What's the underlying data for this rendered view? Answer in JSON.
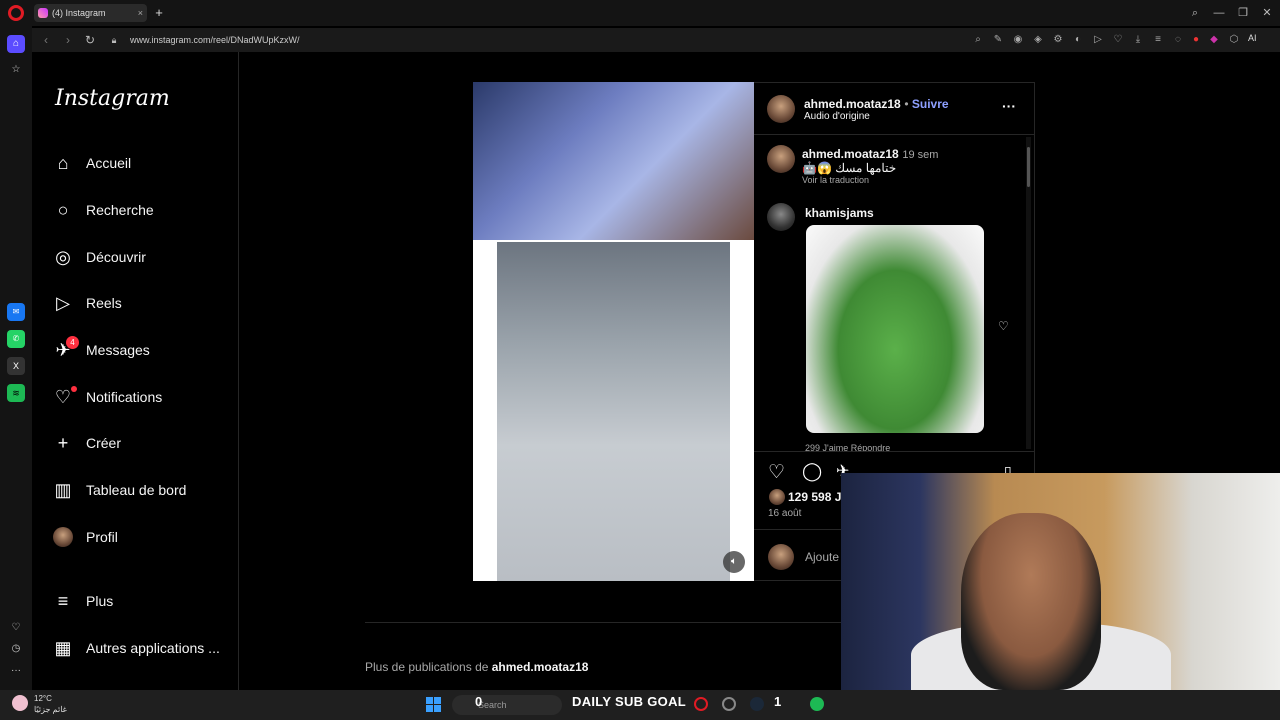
{
  "browser": {
    "tab_title": "(4) Instagram",
    "tab_close": "×",
    "new_tab": "+",
    "url": "www.instagram.com/reel/DNadWUpKzxW/",
    "ai_label": "AI",
    "window_controls": [
      "⌕",
      "—",
      "❐",
      "✕"
    ]
  },
  "nav": {
    "logo": "Instagram",
    "items": [
      {
        "label": "Accueil",
        "icon": "home-icon",
        "glyph": "⌂"
      },
      {
        "label": "Recherche",
        "icon": "search-icon",
        "glyph": "○"
      },
      {
        "label": "Découvrir",
        "icon": "compass-icon",
        "glyph": "◎"
      },
      {
        "label": "Reels",
        "icon": "reels-icon",
        "glyph": "▷"
      },
      {
        "label": "Messages",
        "icon": "messenger-icon",
        "glyph": "✈",
        "badge": "4"
      },
      {
        "label": "Notifications",
        "icon": "heart-icon",
        "glyph": "♡"
      },
      {
        "label": "Créer",
        "icon": "plus-icon",
        "glyph": "+"
      },
      {
        "label": "Tableau de bord",
        "icon": "dashboard-icon",
        "glyph": "▥"
      },
      {
        "label": "Profil",
        "icon": "profile-avatar-icon",
        "glyph": ""
      }
    ],
    "more": "Plus",
    "other_apps": "Autres applications ..."
  },
  "post": {
    "author": "ahmed.moataz18",
    "follow": "Suivre",
    "audio": "Audio d'origine",
    "caption_author": "ahmed.moataz18",
    "caption_time": "19 sem",
    "caption_text": "ختامها مسك 😱🤖",
    "translate": "Voir la traduction",
    "comment_author": "khamisjams",
    "comment_meta": "299 J'aime   Répondre",
    "likes": "129 598 J'a",
    "date": "16 août",
    "add_comment": "Ajoute",
    "more_publications_prefix": "Plus de publications de ",
    "more_publications_user": "ahmed.moataz18"
  },
  "taskbar": {
    "weather_temp": "12°C",
    "weather_desc": "غائم جزئيًا",
    "search_placeholder": "Search",
    "goal_left": "0",
    "goal_text": "DAILY SUB GOAL",
    "goal_right": "1"
  }
}
